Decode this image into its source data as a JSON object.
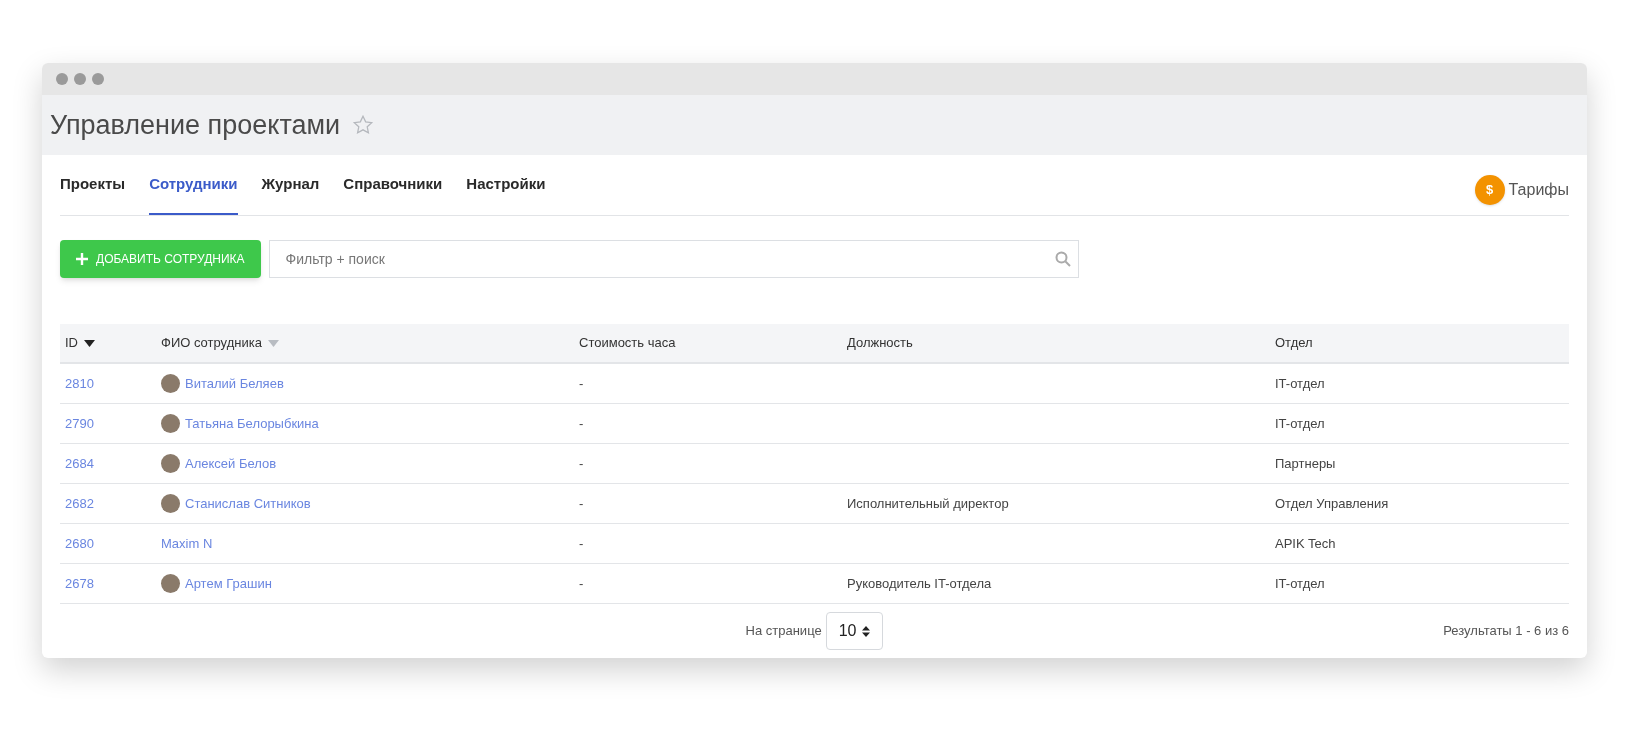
{
  "window": {
    "title": "Управление проектами",
    "favorite": false
  },
  "tabs": [
    {
      "label": "Проекты",
      "selected": false
    },
    {
      "label": "Сотрудники",
      "selected": true
    },
    {
      "label": "Журнал",
      "selected": false
    },
    {
      "label": "Справочники",
      "selected": false
    },
    {
      "label": "Настройки",
      "selected": false
    }
  ],
  "tariffs_link": {
    "icon_text": "$",
    "label": "Тарифы"
  },
  "add_button": {
    "label": "ДОБАВИТЬ СОТРУДНИКА"
  },
  "search": {
    "placeholder": "Фильтр + поиск"
  },
  "table": {
    "columns": [
      {
        "label": "ID",
        "sorted": true
      },
      {
        "label": "ФИО сотрудника",
        "sorted": false
      },
      {
        "label": "Стоимость часа"
      },
      {
        "label": "Должность"
      },
      {
        "label": "Отдел"
      }
    ],
    "rows": [
      {
        "id": "2810",
        "name": "Виталий Беляев",
        "avatar": true,
        "rate": "-",
        "position": "",
        "department": "IT-отдел"
      },
      {
        "id": "2790",
        "name": "Татьяна Белорыбкина",
        "avatar": true,
        "rate": "-",
        "position": "",
        "department": "IT-отдел"
      },
      {
        "id": "2684",
        "name": "Алексей Белов",
        "avatar": true,
        "rate": "-",
        "position": "",
        "department": "Партнеры"
      },
      {
        "id": "2682",
        "name": "Станислав Ситников",
        "avatar": true,
        "rate": "-",
        "position": "Исполнительный директор",
        "department": "Отдел Управления"
      },
      {
        "id": "2680",
        "name": "Maxim N",
        "avatar": false,
        "rate": "-",
        "position": "",
        "department": "APIK Tech"
      },
      {
        "id": "2678",
        "name": "Артем Грашин",
        "avatar": true,
        "rate": "-",
        "position": "Руководитель IT-отдела",
        "department": "IT-отдел"
      }
    ]
  },
  "pagination": {
    "per_page_label": "На странице",
    "per_page": "10",
    "results": "Результаты 1 - 6 из 6"
  }
}
